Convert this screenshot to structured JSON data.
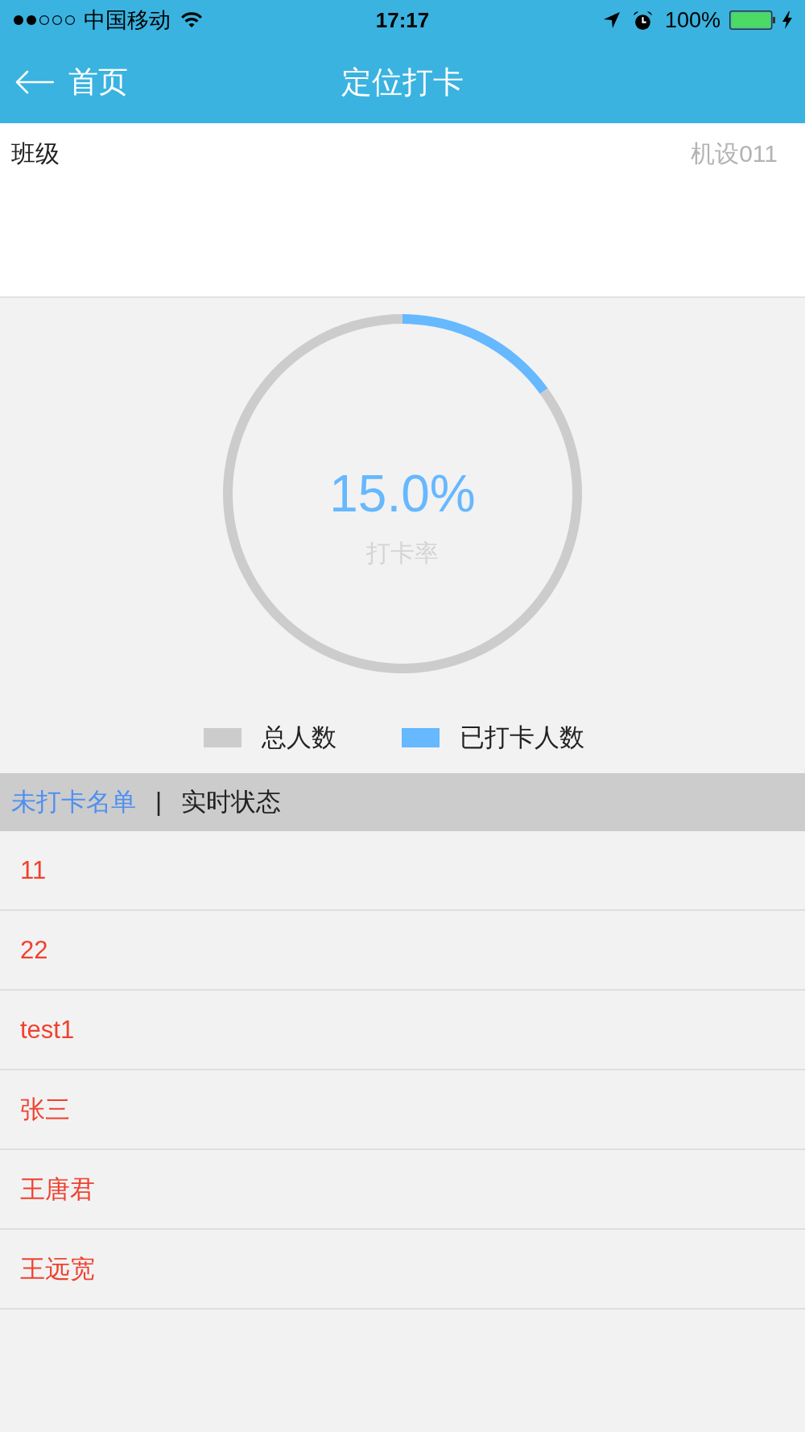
{
  "status_bar": {
    "carrier": "中国移动",
    "time": "17:17",
    "battery": "100%"
  },
  "nav_bar": {
    "back": "首页",
    "title": "定位打卡"
  },
  "class_row": {
    "label": "班级",
    "value": "机设011"
  },
  "rate_chart": {
    "value": "15.0%",
    "caption": "打卡率",
    "slices": [
      {
        "color": "#cccccc"
      },
      {
        "color": "#66b8ff"
      }
    ],
    "chart_data": {
      "type": "donut",
      "categories": [
        "总人数",
        "已打卡人数"
      ],
      "values": [
        85,
        15
      ],
      "legend": "bottom"
    }
  },
  "list_tabs": {
    "tabs": [
      {
        "label": "未打卡名单",
        "selected": true
      },
      {
        "label": "实时状态",
        "selected": false
      }
    ],
    "separator": "|"
  },
  "names": [
    "11",
    "22",
    "test1",
    "张三",
    "王唐君",
    "王远宽"
  ]
}
